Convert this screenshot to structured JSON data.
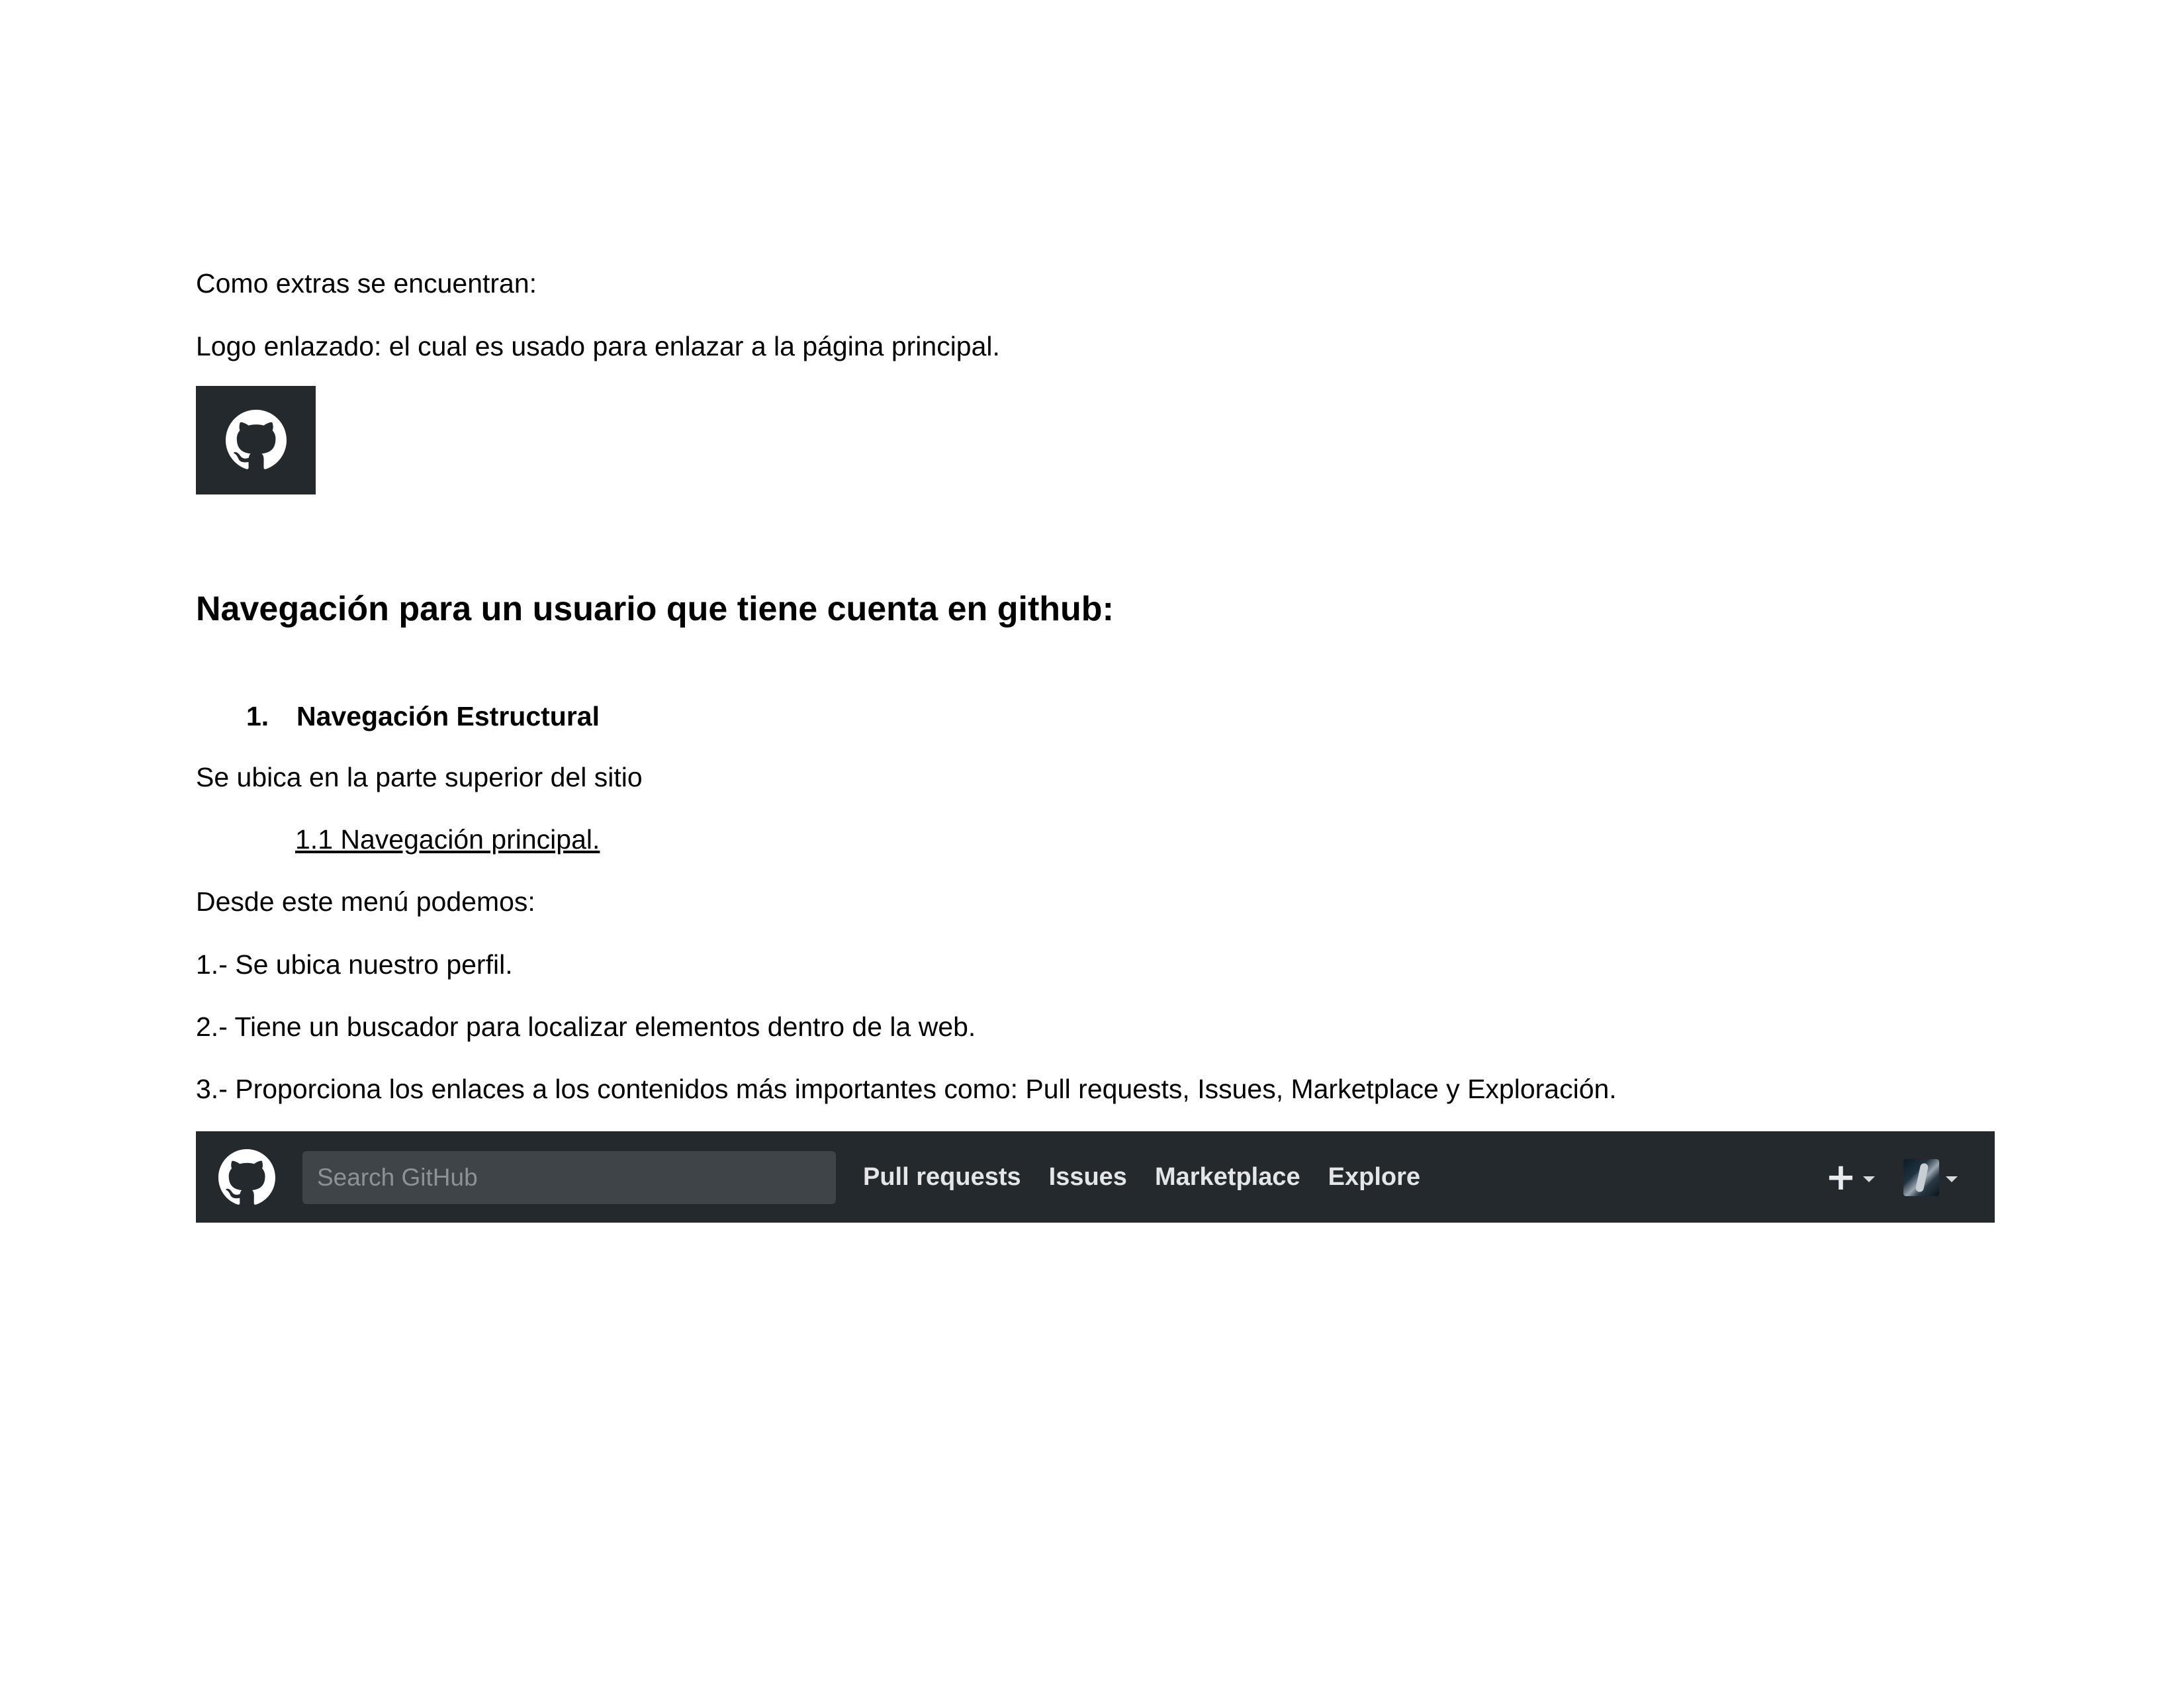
{
  "document": {
    "intro": "Como extras se encuentran:",
    "logo_description": "Logo enlazado: el cual es usado para enlazar a la página principal.",
    "section_heading": "Navegación para un usuario que tiene cuenta en github:",
    "list_item_number": "1.",
    "list_item_title": "Navegación Estructural",
    "location_text": "Se ubica en la parte superior del sitio",
    "subsection_link": "1.1 Navegación principal.",
    "menu_intro": "Desde este menú podemos:",
    "point_1": "1.- Se ubica nuestro perfil.",
    "point_2": "2.- Tiene un buscador para localizar elementos dentro de la web.",
    "point_3": "3.- Proporciona los enlaces a los contenidos más importantes como: Pull requests,  Issues, Marketplace y Exploración."
  },
  "logo_image": {
    "icon": "github-octocat-icon",
    "background": "#24292e"
  },
  "navbar": {
    "background": "#24292e",
    "logo_icon": "github-octocat-icon",
    "search_placeholder": "Search GitHub",
    "links": [
      "Pull requests",
      "Issues",
      "Marketplace",
      "Explore"
    ],
    "plus_icon": "plus-icon",
    "avatar_icon": "user-avatar"
  }
}
